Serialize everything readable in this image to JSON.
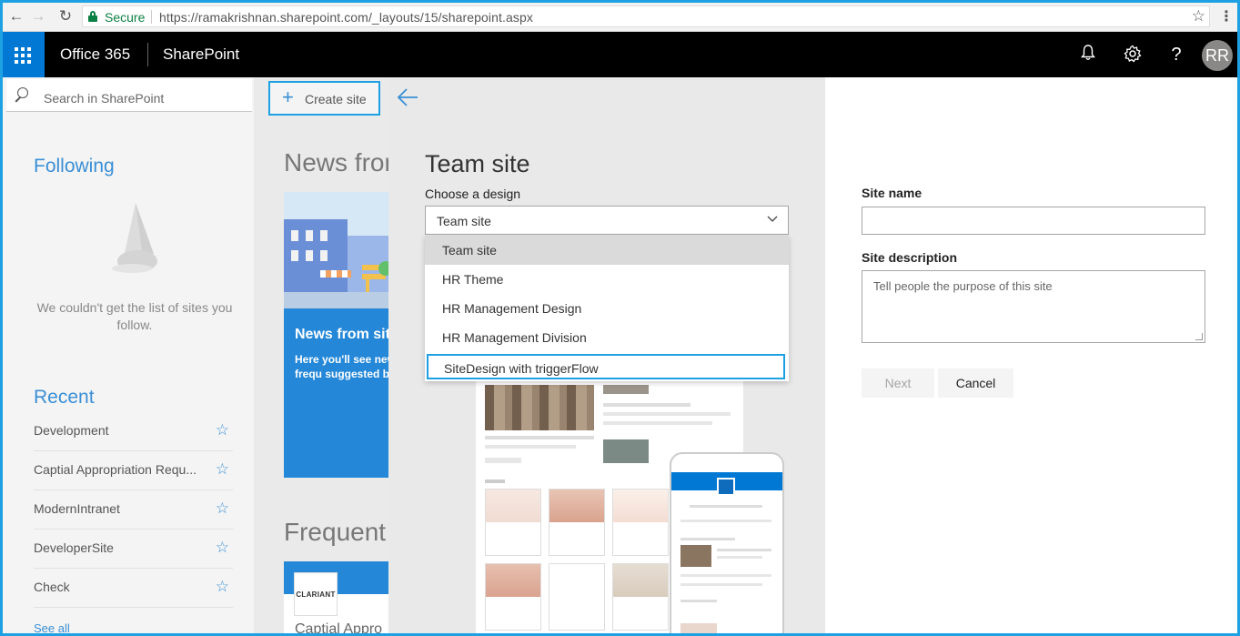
{
  "browser": {
    "back_icon": "back-arrow-icon",
    "forward_icon": "forward-arrow-icon",
    "reload_icon": "reload-icon",
    "secure_label": "Secure",
    "url": "https://ramakrishnan.sharepoint.com/_layouts/15/sharepoint.aspx",
    "bookmark_icon": "star-outline-icon",
    "menu_icon": "kebab-menu-icon"
  },
  "suite_bar": {
    "app_launcher_icon": "waffle-icon",
    "product": "Office 365",
    "app": "SharePoint",
    "icons": [
      "bell-icon",
      "gear-icon",
      "help-icon"
    ],
    "avatar_initials": "RR",
    "colors": {
      "bar": "#000000",
      "launcher": "#0078d4"
    }
  },
  "left_nav": {
    "search_placeholder": "Search in SharePoint",
    "following_title": "Following",
    "following_empty": "We couldn't get the list of sites you follow.",
    "recent_title": "Recent",
    "recent_items": [
      {
        "label": "Development"
      },
      {
        "label": "Captial Appropriation Requ..."
      },
      {
        "label": "ModernIntranet"
      },
      {
        "label": "DeveloperSite"
      },
      {
        "label": "Check"
      }
    ],
    "see_all": "See all"
  },
  "main": {
    "create_site_label": "Create site",
    "news_title": "News from",
    "news_card_title": "News from sit",
    "news_card_text": "Here you'll see new follow or visit frequ suggested by the M",
    "frequent_title": "Frequent s",
    "frequent_card_logo": "CLARIANT",
    "frequent_card_name": "Captial Appro"
  },
  "panel": {
    "title": "Team site",
    "choose_design_label": "Choose a design",
    "selected_design": "Team site",
    "design_options": [
      {
        "label": "Team site",
        "state": "selected"
      },
      {
        "label": "HR Theme",
        "state": "normal"
      },
      {
        "label": "HR Management Design",
        "state": "normal"
      },
      {
        "label": "HR Management Division",
        "state": "normal"
      },
      {
        "label": "SiteDesign with triggerFlow",
        "state": "highlighted"
      }
    ],
    "site_name_label": "Site name",
    "site_name_value": "",
    "site_description_label": "Site description",
    "site_description_placeholder": "Tell people the purpose of this site",
    "next_label": "Next",
    "cancel_label": "Cancel",
    "accent_color": "#1ea1e2"
  }
}
